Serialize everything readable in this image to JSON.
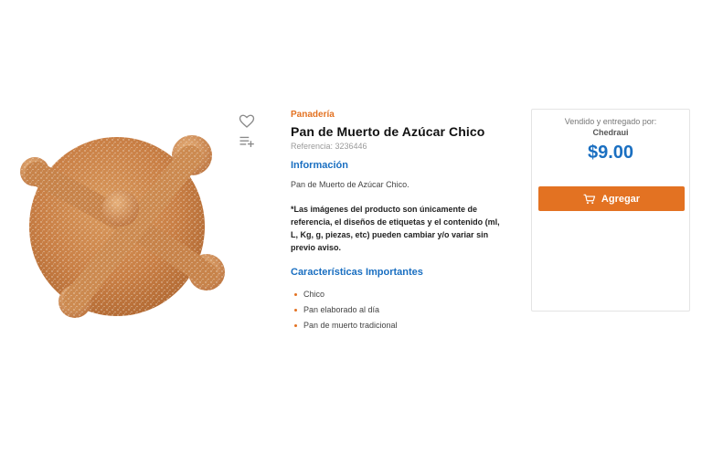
{
  "product": {
    "image_alt": "Pan de Muerto de Azúcar Chico",
    "category": "Panadería",
    "title": "Pan de Muerto de Azúcar Chico",
    "reference": "Referencia: 3236446",
    "info_heading": "Información",
    "description": "Pan de Muerto de Azúcar Chico.",
    "disclaimer": "*Las imágenes del producto son únicamente de referencia, el diseños de etiquetas y el contenido (ml, L, Kg, g, piezas, etc) pueden cambiar y/o variar sin previo aviso.",
    "features_heading": "Características Importantes",
    "features": [
      "Chico",
      "Pan elaborado al día",
      "Pan de muerto tradicional"
    ]
  },
  "actions": {
    "favorite_icon": "heart-icon",
    "add_to_list_icon": "playlist-add-icon"
  },
  "purchase": {
    "sold_by_label": "Vendido y entregado por:",
    "seller": "Chedraui",
    "price": "$9.00",
    "add_button_label": "Agregar",
    "add_button_icon": "cart-icon"
  },
  "colors": {
    "accent_orange": "#e37222",
    "accent_blue": "#1a6fc1"
  }
}
